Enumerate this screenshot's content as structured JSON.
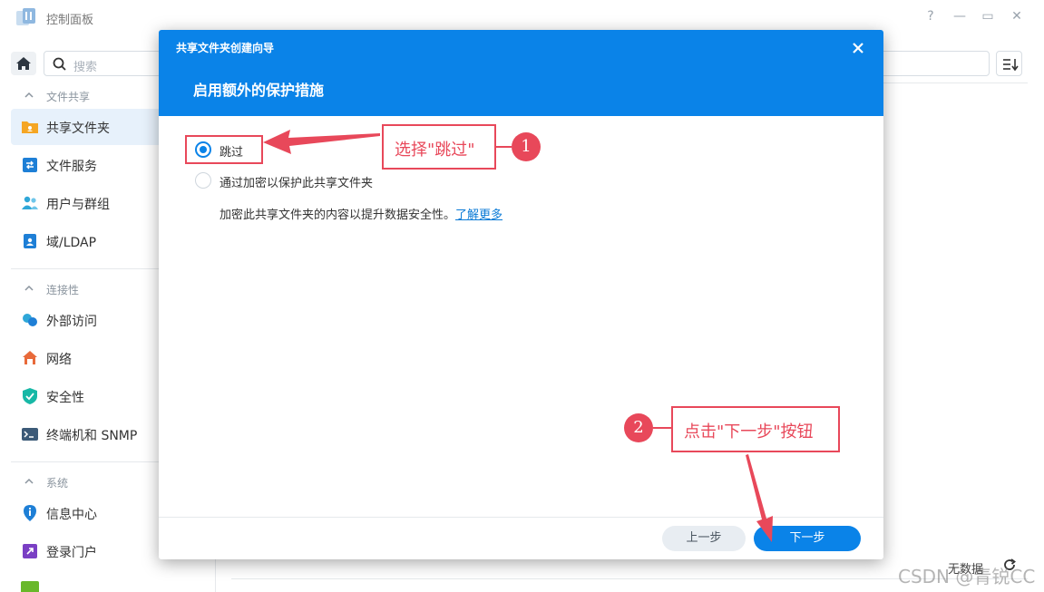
{
  "window": {
    "title": "控制面板",
    "help_glyph": "?",
    "minimize_glyph": "—",
    "maximize_glyph": "▭",
    "close_glyph": "✕"
  },
  "search": {
    "placeholder": "搜索"
  },
  "sidebar": {
    "sections": [
      {
        "label": "文件共享",
        "items": [
          {
            "label": "共享文件夹",
            "icon": "shared-folder-icon",
            "active": true
          },
          {
            "label": "文件服务",
            "icon": "file-services-icon"
          },
          {
            "label": "用户与群组",
            "icon": "users-icon"
          },
          {
            "label": "域/LDAP",
            "icon": "ldap-icon"
          }
        ]
      },
      {
        "label": "连接性",
        "items": [
          {
            "label": "外部访问",
            "icon": "external-access-icon"
          },
          {
            "label": "网络",
            "icon": "network-icon"
          },
          {
            "label": "安全性",
            "icon": "security-icon"
          },
          {
            "label": "终端机和 SNMP",
            "icon": "terminal-icon"
          }
        ]
      },
      {
        "label": "系统",
        "items": [
          {
            "label": "信息中心",
            "icon": "info-center-icon"
          },
          {
            "label": "登录门户",
            "icon": "login-portal-icon"
          }
        ]
      }
    ]
  },
  "content": {
    "nodata": "无数据"
  },
  "dialog": {
    "title": "共享文件夹创建向导",
    "subtitle": "启用额外的保护措施",
    "options": [
      {
        "label": "跳过",
        "selected": true
      },
      {
        "label": "通过加密以保护此共享文件夹",
        "selected": false
      }
    ],
    "description": "加密此共享文件夹的内容以提升数据安全性。",
    "learn_more": "了解更多",
    "prev_button": "上一步",
    "next_button": "下一步"
  },
  "annotations": {
    "callout1": {
      "number": "1",
      "text": "选择\"跳过\""
    },
    "callout2": {
      "number": "2",
      "text": "点击\"下一步\"按钮"
    },
    "color": "#e8485a"
  },
  "watermark": "CSDN @青锐CC",
  "colors": {
    "accent": "#0a83e8",
    "annotation": "#e8485a"
  }
}
